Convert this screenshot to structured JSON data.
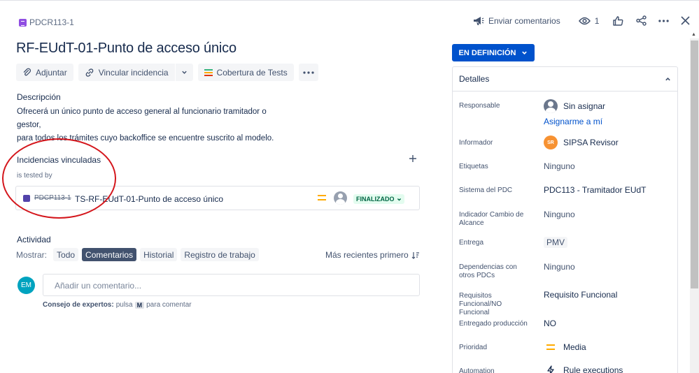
{
  "issue": {
    "key": "PDCR113-1",
    "title": "RF-EUdT-01-Punto de acceso único"
  },
  "toolbar": {
    "attach": "Adjuntar",
    "link_issue": "Vincular incidencia",
    "test_coverage": "Cobertura de Tests"
  },
  "description": {
    "heading": "Descripción",
    "line1": "Ofrecerá un único punto de acceso general al funcionario tramitador o gestor,",
    "line2": "para todos los trámites cuyo backoffice se encuentre suscrito al modelo."
  },
  "linked_issues": {
    "heading": "Incidencias vinculadas",
    "relation": "is tested by",
    "items": [
      {
        "key": "PDCP113-1",
        "title": "TS-RF-EUdT-01-Punto de acceso único",
        "status": "FINALIZADO"
      }
    ]
  },
  "activity": {
    "heading": "Actividad",
    "show_label": "Mostrar:",
    "filters": [
      "Todo",
      "Comentarios",
      "Historial",
      "Registro de trabajo"
    ],
    "active_filter": "Comentarios",
    "sort": "Más recientes primero",
    "avatar_initials": "EM",
    "comment_placeholder": "Añadir un comentario...",
    "tip_bold": "Consejo de expertos:",
    "tip_press": "pulsa",
    "tip_key": "M",
    "tip_rest": "para comentar"
  },
  "topbar": {
    "feedback": "Enviar comentarios",
    "watchers": "1"
  },
  "status": {
    "label": "EN DEFINICIÓN"
  },
  "details": {
    "heading": "Detalles",
    "fields": {
      "assignee_label": "Responsable",
      "assignee_value": "Sin asignar",
      "assign_me": "Asignarme a mí",
      "reporter_label": "Informador",
      "reporter_initials": "SR",
      "reporter_value": "SIPSA Revisor",
      "labels_label": "Etiquetas",
      "labels_value": "Ninguno",
      "pdc_system_label": "Sistema del PDC",
      "pdc_system_value": "PDC113 - Tramitador EUdT",
      "scope_label": "Indicador Cambio de Alcance",
      "scope_value": "Ninguno",
      "delivery_label": "Entrega",
      "delivery_value": "PMV",
      "deps_label": "Dependencias con otros PDCs",
      "deps_value": "Ninguno",
      "req_label": "Requisitos Funcional/NO Funcional",
      "req_value": "Requisito Funcional",
      "delivered_label": "Entregado producción",
      "delivered_value": "NO",
      "priority_label": "Prioridad",
      "priority_value": "Media",
      "automation_label": "Automation",
      "automation_value": "Rule executions"
    }
  },
  "colors": {
    "primary": "#0052cc",
    "issue_type": "#904ee2",
    "linked_type": "#5243aa",
    "priority_medium": "#ffab00",
    "done_bg": "#e3fcef",
    "done_fg": "#006644",
    "annotation_red": "#d4161c"
  }
}
